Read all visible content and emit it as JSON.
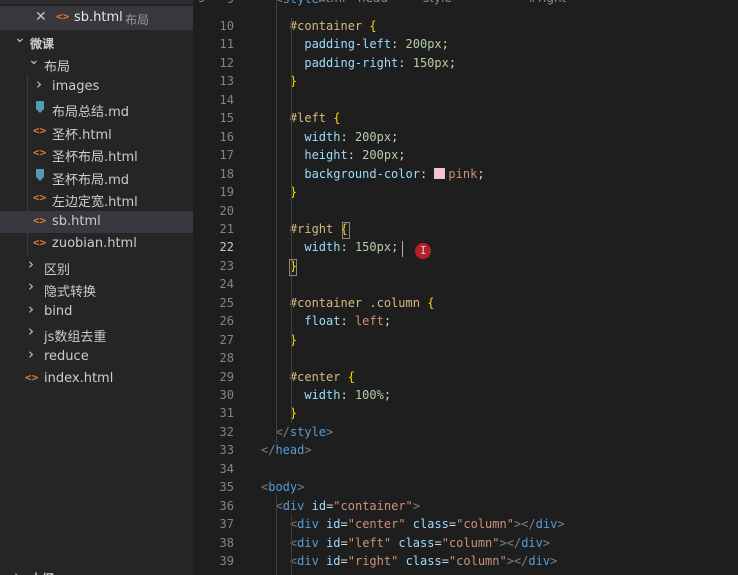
{
  "open_editor": {
    "close": "✕",
    "icon": "<>",
    "filename": "sb.html",
    "folder": "布局"
  },
  "breadcrumb": [
    "9",
    "html",
    "head",
    "style",
    "#right"
  ],
  "explorer": {
    "root": "微课",
    "items": [
      {
        "label": "布局",
        "kind": "folder-open"
      },
      {
        "label": "images",
        "kind": "folder"
      },
      {
        "label": "布局总结.md",
        "kind": "md"
      },
      {
        "label": "圣杯.html",
        "kind": "html"
      },
      {
        "label": "圣杯布局.html",
        "kind": "html"
      },
      {
        "label": "圣杯布局.md",
        "kind": "md"
      },
      {
        "label": "左边定宽.html",
        "kind": "html"
      },
      {
        "label": "sb.html",
        "kind": "html",
        "selected": true
      },
      {
        "label": "zuobian.html",
        "kind": "html"
      },
      {
        "label": "区别",
        "kind": "folder"
      },
      {
        "label": "隐式转换",
        "kind": "folder"
      },
      {
        "label": "bind",
        "kind": "folder"
      },
      {
        "label": "js数组去重",
        "kind": "folder"
      },
      {
        "label": "reduce",
        "kind": "folder"
      },
      {
        "label": "index.html",
        "kind": "html"
      }
    ],
    "bottom_section": "大纲"
  },
  "editor": {
    "current_line": 22,
    "lines": [
      {
        "n": "10",
        "tokens": [
          [
            "    ",
            "t-plain"
          ],
          [
            "#container",
            "t-sel"
          ],
          [
            " ",
            "t-plain"
          ],
          [
            "{",
            "t-brace"
          ]
        ]
      },
      {
        "n": "11",
        "tokens": [
          [
            "      ",
            "t-plain"
          ],
          [
            "padding-left",
            "t-prop"
          ],
          [
            ": ",
            "t-plain"
          ],
          [
            "200px",
            "t-num"
          ],
          [
            ";",
            "t-plain"
          ]
        ]
      },
      {
        "n": "12",
        "tokens": [
          [
            "      ",
            "t-plain"
          ],
          [
            "padding-right",
            "t-prop"
          ],
          [
            ": ",
            "t-plain"
          ],
          [
            "150px",
            "t-num"
          ],
          [
            ";",
            "t-plain"
          ]
        ]
      },
      {
        "n": "13",
        "tokens": [
          [
            "    ",
            "t-plain"
          ],
          [
            "}",
            "t-brace"
          ]
        ]
      },
      {
        "n": "14",
        "tokens": []
      },
      {
        "n": "15",
        "tokens": [
          [
            "    ",
            "t-plain"
          ],
          [
            "#left",
            "t-sel"
          ],
          [
            " ",
            "t-plain"
          ],
          [
            "{",
            "t-brace"
          ]
        ]
      },
      {
        "n": "16",
        "tokens": [
          [
            "      ",
            "t-plain"
          ],
          [
            "width",
            "t-prop"
          ],
          [
            ": ",
            "t-plain"
          ],
          [
            "200px",
            "t-num"
          ],
          [
            ";",
            "t-plain"
          ]
        ]
      },
      {
        "n": "17",
        "tokens": [
          [
            "      ",
            "t-plain"
          ],
          [
            "height",
            "t-prop"
          ],
          [
            ": ",
            "t-plain"
          ],
          [
            "200px",
            "t-num"
          ],
          [
            ";",
            "t-plain"
          ]
        ]
      },
      {
        "n": "18",
        "tokens": [
          [
            "      ",
            "t-plain"
          ],
          [
            "background-color",
            "t-prop"
          ],
          [
            ": ",
            "t-plain"
          ],
          [
            "__SWATCH__",
            "t-plain"
          ],
          [
            "pink",
            "t-val"
          ],
          [
            ";",
            "t-plain"
          ]
        ]
      },
      {
        "n": "19",
        "tokens": [
          [
            "    ",
            "t-plain"
          ],
          [
            "}",
            "t-brace"
          ]
        ]
      },
      {
        "n": "20",
        "tokens": []
      },
      {
        "n": "21",
        "tokens": [
          [
            "    ",
            "t-plain"
          ],
          [
            "#right",
            "t-sel"
          ],
          [
            " ",
            "t-plain"
          ],
          [
            "{",
            "t-brace"
          ]
        ]
      },
      {
        "n": "22",
        "tokens": [
          [
            "      ",
            "t-plain"
          ],
          [
            "width",
            "t-prop"
          ],
          [
            ": ",
            "t-plain"
          ],
          [
            "150px",
            "t-num"
          ],
          [
            ";",
            "t-plain"
          ]
        ]
      },
      {
        "n": "23",
        "tokens": [
          [
            "    ",
            "t-plain"
          ],
          [
            "}",
            "t-brace"
          ]
        ]
      },
      {
        "n": "24",
        "tokens": []
      },
      {
        "n": "25",
        "tokens": [
          [
            "    ",
            "t-plain"
          ],
          [
            "#container .column",
            "t-sel"
          ],
          [
            " ",
            "t-plain"
          ],
          [
            "{",
            "t-brace"
          ]
        ]
      },
      {
        "n": "26",
        "tokens": [
          [
            "      ",
            "t-plain"
          ],
          [
            "float",
            "t-prop"
          ],
          [
            ": ",
            "t-plain"
          ],
          [
            "left",
            "t-val"
          ],
          [
            ";",
            "t-plain"
          ]
        ]
      },
      {
        "n": "27",
        "tokens": [
          [
            "    ",
            "t-plain"
          ],
          [
            "}",
            "t-brace"
          ]
        ]
      },
      {
        "n": "28",
        "tokens": []
      },
      {
        "n": "29",
        "tokens": [
          [
            "    ",
            "t-plain"
          ],
          [
            "#center",
            "t-sel"
          ],
          [
            " ",
            "t-plain"
          ],
          [
            "{",
            "t-brace"
          ]
        ]
      },
      {
        "n": "30",
        "tokens": [
          [
            "      ",
            "t-plain"
          ],
          [
            "width",
            "t-prop"
          ],
          [
            ": ",
            "t-plain"
          ],
          [
            "100%",
            "t-num"
          ],
          [
            ";",
            "t-plain"
          ]
        ]
      },
      {
        "n": "31",
        "tokens": [
          [
            "    ",
            "t-plain"
          ],
          [
            "}",
            "t-brace"
          ]
        ]
      },
      {
        "n": "32",
        "tokens": [
          [
            "  ",
            "t-plain"
          ],
          [
            "</",
            "t-punc"
          ],
          [
            "style",
            "t-tag"
          ],
          [
            ">",
            "t-punc"
          ]
        ]
      },
      {
        "n": "33",
        "tokens": [
          [
            "</",
            "t-punc"
          ],
          [
            "head",
            "t-tag"
          ],
          [
            ">",
            "t-punc"
          ]
        ]
      },
      {
        "n": "34",
        "tokens": []
      },
      {
        "n": "35",
        "tokens": [
          [
            "<",
            "t-punc"
          ],
          [
            "body",
            "t-tag"
          ],
          [
            ">",
            "t-punc"
          ]
        ]
      },
      {
        "n": "36",
        "tokens": [
          [
            "  ",
            "t-plain"
          ],
          [
            "<",
            "t-punc"
          ],
          [
            "div",
            "t-tag"
          ],
          [
            " ",
            "t-plain"
          ],
          [
            "id",
            "t-attr"
          ],
          [
            "=",
            "t-plain"
          ],
          [
            "\"container\"",
            "t-str"
          ],
          [
            ">",
            "t-punc"
          ]
        ]
      },
      {
        "n": "37",
        "tokens": [
          [
            "    ",
            "t-plain"
          ],
          [
            "<",
            "t-punc"
          ],
          [
            "div",
            "t-tag"
          ],
          [
            " ",
            "t-plain"
          ],
          [
            "id",
            "t-attr"
          ],
          [
            "=",
            "t-plain"
          ],
          [
            "\"center\"",
            "t-str"
          ],
          [
            " ",
            "t-plain"
          ],
          [
            "class",
            "t-attr"
          ],
          [
            "=",
            "t-plain"
          ],
          [
            "\"column\"",
            "t-str"
          ],
          [
            "></",
            "t-punc"
          ],
          [
            "div",
            "t-tag"
          ],
          [
            ">",
            "t-punc"
          ]
        ]
      },
      {
        "n": "38",
        "tokens": [
          [
            "    ",
            "t-plain"
          ],
          [
            "<",
            "t-punc"
          ],
          [
            "div",
            "t-tag"
          ],
          [
            " ",
            "t-plain"
          ],
          [
            "id",
            "t-attr"
          ],
          [
            "=",
            "t-plain"
          ],
          [
            "\"left\"",
            "t-str"
          ],
          [
            " ",
            "t-plain"
          ],
          [
            "class",
            "t-attr"
          ],
          [
            "=",
            "t-plain"
          ],
          [
            "\"column\"",
            "t-str"
          ],
          [
            "></",
            "t-punc"
          ],
          [
            "div",
            "t-tag"
          ],
          [
            ">",
            "t-punc"
          ]
        ]
      },
      {
        "n": "39",
        "tokens": [
          [
            "    ",
            "t-plain"
          ],
          [
            "<",
            "t-punc"
          ],
          [
            "div",
            "t-tag"
          ],
          [
            " ",
            "t-plain"
          ],
          [
            "id",
            "t-attr"
          ],
          [
            "=",
            "t-plain"
          ],
          [
            "\"right\"",
            "t-str"
          ],
          [
            " ",
            "t-plain"
          ],
          [
            "class",
            "t-attr"
          ],
          [
            "=",
            "t-plain"
          ],
          [
            "\"column\"",
            "t-str"
          ],
          [
            "></",
            "t-punc"
          ],
          [
            "div",
            "t-tag"
          ],
          [
            ">",
            "t-punc"
          ]
        ]
      }
    ],
    "partial_top_line": {
      "n": "9",
      "tokens": [
        [
          "  ",
          "t-plain"
        ],
        [
          "<",
          "t-punc"
        ],
        [
          "style",
          "t-tag"
        ],
        [
          ">",
          "t-punc"
        ]
      ]
    },
    "pointer_glyph": "I"
  }
}
